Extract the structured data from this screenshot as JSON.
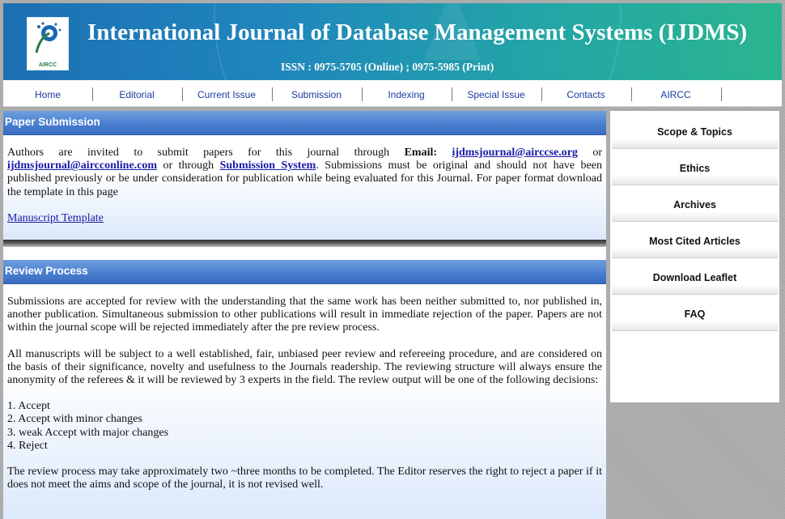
{
  "header": {
    "title": "International Journal of Database Management Systems (IJDMS)",
    "issn": "ISSN : 0975-5705 (Online) ; 0975-5985 (Print)",
    "logo_text": "AIRCC"
  },
  "nav": {
    "items": [
      "Home",
      "Editorial",
      "Current Issue",
      "Submission",
      "Indexing",
      "Special Issue",
      "Contacts",
      "AIRCC"
    ]
  },
  "paper_submission": {
    "heading": "Paper Submission",
    "intro_1": "Authors are invited to submit papers for this journal through",
    "email_label": "Email:",
    "email_1": "ijdmsjournal@airccse.org",
    "or_1": "or",
    "email_2": "ijdmsjournal@aircconline.com",
    "or_through": "or through",
    "submission_system": "Submission System",
    "intro_2": ". Submissions must be original and should not have been published previously or be under consideration for publication while being evaluated for this Journal. For paper format download the template in this page",
    "template_link": "Manuscript Template"
  },
  "review_process": {
    "heading": "Review Process",
    "para_1": "Submissions are accepted for review with the understanding that the same work has been neither submitted to, nor published in, another publication. Simultaneous submission to other publications will result in immediate rejection of the paper. Papers are not within the journal scope will be rejected immediately after the pre review process.",
    "para_2": "All manuscripts will be subject to a well established, fair, unbiased peer review and refereeing procedure, and are considered on the basis of their significance, novelty and usefulness to the Journals readership. The reviewing structure will always ensure the anonymity of the referees & it will be reviewed by 3 experts in the field. The review output will be one of the following decisions:",
    "decisions": [
      "1. Accept",
      "2. Accept with minor changes",
      "3. weak Accept with major changes",
      "4. Reject"
    ],
    "para_3": "The review process may take approximately two ~three months to be completed. The Editor reserves the right to reject a paper if it does not meet the aims and scope of the journal, it is not revised well."
  },
  "sidebar": {
    "items": [
      "Scope & Topics",
      "Ethics",
      "Archives",
      "Most Cited Articles",
      "Download Leaflet",
      "FAQ"
    ]
  }
}
